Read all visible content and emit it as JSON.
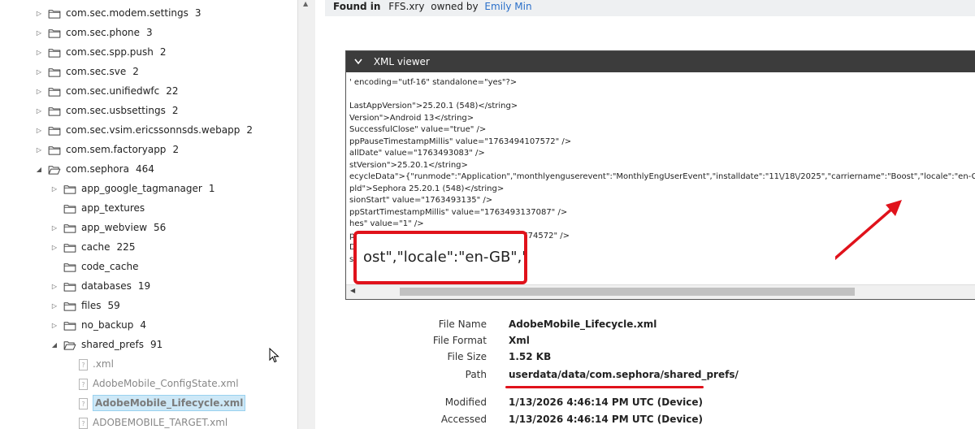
{
  "tree": {
    "items": [
      {
        "label": "com.sec.modem.settings",
        "count": "3",
        "level": 0,
        "expanded": false,
        "type": "folder"
      },
      {
        "label": "com.sec.phone",
        "count": "3",
        "level": 0,
        "expanded": false,
        "type": "folder"
      },
      {
        "label": "com.sec.spp.push",
        "count": "2",
        "level": 0,
        "expanded": false,
        "type": "folder"
      },
      {
        "label": "com.sec.sve",
        "count": "2",
        "level": 0,
        "expanded": false,
        "type": "folder"
      },
      {
        "label": "com.sec.unifiedwfc",
        "count": "22",
        "level": 0,
        "expanded": false,
        "type": "folder"
      },
      {
        "label": "com.sec.usbsettings",
        "count": "2",
        "level": 0,
        "expanded": false,
        "type": "folder"
      },
      {
        "label": "com.sec.vsim.ericssonnsds.webapp",
        "count": "2",
        "level": 0,
        "expanded": false,
        "type": "folder"
      },
      {
        "label": "com.sem.factoryapp",
        "count": "2",
        "level": 0,
        "expanded": false,
        "type": "folder"
      },
      {
        "label": "com.sephora",
        "count": "464",
        "level": 0,
        "expanded": true,
        "type": "folder"
      },
      {
        "label": "app_google_tagmanager",
        "count": "1",
        "level": 1,
        "expanded": false,
        "type": "folder"
      },
      {
        "label": "app_textures",
        "count": "",
        "level": 1,
        "expanded": null,
        "type": "folder"
      },
      {
        "label": "app_webview",
        "count": "56",
        "level": 1,
        "expanded": false,
        "type": "folder"
      },
      {
        "label": "cache",
        "count": "225",
        "level": 1,
        "expanded": false,
        "type": "folder"
      },
      {
        "label": "code_cache",
        "count": "",
        "level": 1,
        "expanded": null,
        "type": "folder"
      },
      {
        "label": "databases",
        "count": "19",
        "level": 1,
        "expanded": false,
        "type": "folder"
      },
      {
        "label": "files",
        "count": "59",
        "level": 1,
        "expanded": false,
        "type": "folder"
      },
      {
        "label": "no_backup",
        "count": "4",
        "level": 1,
        "expanded": false,
        "type": "folder"
      },
      {
        "label": "shared_prefs",
        "count": "91",
        "level": 1,
        "expanded": true,
        "type": "folder"
      },
      {
        "label": ".xml",
        "count": "",
        "level": 2,
        "expanded": null,
        "type": "file"
      },
      {
        "label": "AdobeMobile_ConfigState.xml",
        "count": "",
        "level": 2,
        "expanded": null,
        "type": "file"
      },
      {
        "label": "AdobeMobile_Lifecycle.xml",
        "count": "",
        "level": 2,
        "expanded": null,
        "type": "file",
        "selected": true
      },
      {
        "label": "ADOBEMOBILE_TARGET.xml",
        "count": "",
        "level": 2,
        "expanded": null,
        "type": "file"
      }
    ]
  },
  "found": {
    "prefix": "Found in",
    "source": "FFS.xry",
    "owned_by": "owned by",
    "owner": "Emily Min"
  },
  "xml_viewer": {
    "title": "XML viewer",
    "lines": [
      "' encoding=\"utf-16\" standalone=\"yes\"?>",
      "",
      "LastAppVersion\">25.20.1 (548)</string>",
      "Version\">Android 13</string>",
      "SuccessfulClose\" value=\"true\" />",
      "ppPauseTimestampMillis\" value=\"1763494107572\" />",
      "allDate\" value=\"1763493083\" />",
      "stVersion\">25.20.1</string>",
      "ecycleData\">{\"runmode\":\"Application\",\"monthlyenguserevent\":\"MonthlyEngUserEvent\",\"installdate\":\"11\\/18\\/2025\",\"carriername\":\"Boost\",\"locale\":\"en-GB\",\"resolution",
      "pld\">Sephora 25.20.1 (548)</string>",
      "sionStart\" value=\"1763493135\" />",
      "ppStartTimestampMillis\" value=\"1763493137087\" />",
      "hes\" value=\"1\" />",
      "ppCloseTimestampMillis\" value=\"1768322774572\" />",
      "DateUsed\" value=\"1763493083\" />",
      "seDate\" value=\"1763494107\" />"
    ],
    "zoom_text": "ost\",\"locale\":\"en-GB\",\"re"
  },
  "properties": {
    "rows": [
      {
        "label": "File Name",
        "value": "AdobeMobile_Lifecycle.xml"
      },
      {
        "label": "File Format",
        "value": "Xml"
      },
      {
        "label": "File Size",
        "value": "1.52 KB"
      },
      {
        "label": "Path",
        "value": "userdata/data/com.sephora/shared_prefs/"
      },
      {
        "label": "Modified",
        "value": "1/13/2026 4:46:14 PM UTC (Device)"
      },
      {
        "label": "Accessed",
        "value": "1/13/2026 4:46:14 PM UTC (Device)"
      }
    ]
  },
  "colors": {
    "highlight_red": "#e0121b",
    "link_blue": "#2a6fc9",
    "selection_bg": "#cde8f7"
  }
}
